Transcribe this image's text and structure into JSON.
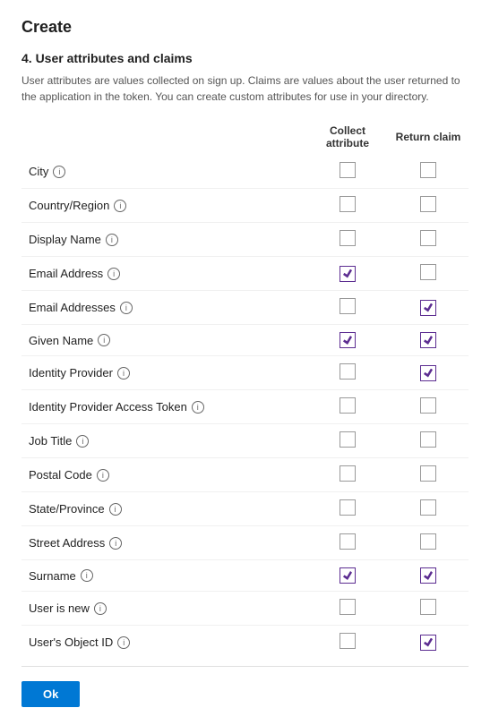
{
  "page": {
    "title": "Create",
    "section_number": "4. User attributes and claims",
    "description": "User attributes are values collected on sign up. Claims are values about the user returned to the application in the token. You can create custom attributes for use in your directory.",
    "columns": {
      "attribute": "Collect attribute",
      "claim": "Return claim"
    },
    "rows": [
      {
        "id": "city",
        "label": "City",
        "collect": false,
        "return": false
      },
      {
        "id": "country_region",
        "label": "Country/Region",
        "collect": false,
        "return": false
      },
      {
        "id": "display_name",
        "label": "Display Name",
        "collect": false,
        "return": false
      },
      {
        "id": "email_address",
        "label": "Email Address",
        "collect": true,
        "return": false
      },
      {
        "id": "email_addresses",
        "label": "Email Addresses",
        "collect": false,
        "return": true
      },
      {
        "id": "given_name",
        "label": "Given Name",
        "collect": true,
        "return": true
      },
      {
        "id": "identity_provider",
        "label": "Identity Provider",
        "collect": false,
        "return": true
      },
      {
        "id": "identity_provider_access_token",
        "label": "Identity Provider Access Token",
        "collect": false,
        "return": false
      },
      {
        "id": "job_title",
        "label": "Job Title",
        "collect": false,
        "return": false
      },
      {
        "id": "postal_code",
        "label": "Postal Code",
        "collect": false,
        "return": false
      },
      {
        "id": "state_province",
        "label": "State/Province",
        "collect": false,
        "return": false
      },
      {
        "id": "street_address",
        "label": "Street Address",
        "collect": false,
        "return": false
      },
      {
        "id": "surname",
        "label": "Surname",
        "collect": true,
        "return": true
      },
      {
        "id": "user_is_new",
        "label": "User is new",
        "collect": false,
        "return": false
      },
      {
        "id": "users_object_id",
        "label": "User's Object ID",
        "collect": false,
        "return": true
      }
    ],
    "ok_button_label": "Ok"
  }
}
